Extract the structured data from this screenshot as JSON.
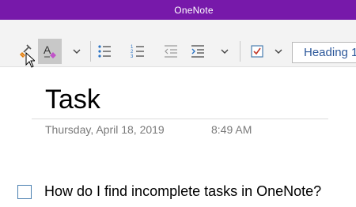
{
  "window": {
    "title": "OneNote"
  },
  "ribbon": {
    "buttons": [
      {
        "name": "format-painter",
        "icon": "format-painter-icon"
      },
      {
        "name": "clear-formatting",
        "icon": "clear-formatting-icon",
        "pressed": true
      },
      {
        "name": "more-formatting-dropdown",
        "icon": "chevron-down-icon"
      },
      {
        "name": "bullets",
        "icon": "bulleted-list-icon"
      },
      {
        "name": "numbering",
        "icon": "numbered-list-icon"
      },
      {
        "name": "decrease-indent",
        "icon": "outdent-icon"
      },
      {
        "name": "increase-indent",
        "icon": "indent-icon"
      },
      {
        "name": "paragraph-dropdown",
        "icon": "chevron-down-icon"
      },
      {
        "name": "todo-tag",
        "icon": "checkbox-checked-icon"
      },
      {
        "name": "tags-dropdown",
        "icon": "chevron-down-icon"
      }
    ],
    "style_selector": {
      "value": "Heading 1"
    }
  },
  "page": {
    "title": "Task",
    "date": "Thursday, April 18, 2019",
    "time": "8:49 AM",
    "todo_item": {
      "text": "How do I find incomplete tasks in OneNote?",
      "checked": false
    }
  },
  "colors": {
    "title_bar": "#7719aa",
    "ribbon_background": "#f3f3f3",
    "accent_blue": "#2b579a",
    "checkbox_border": "#4a7fb0",
    "pressed_button": "#c8c8c8"
  }
}
